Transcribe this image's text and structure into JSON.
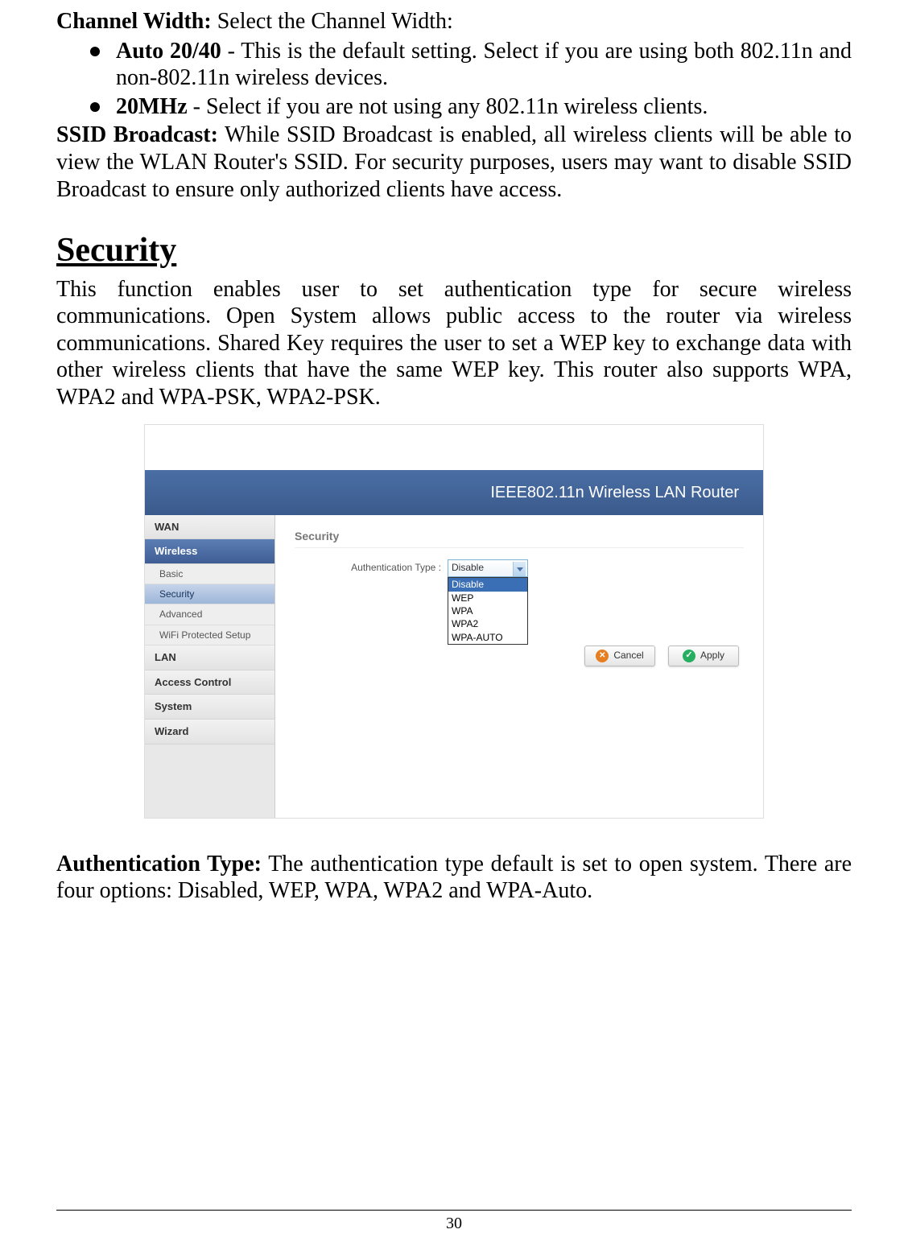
{
  "channel_width": {
    "label": "Channel Width:",
    "desc": " Select the Channel Width:",
    "auto": {
      "label": "Auto 20/40",
      "desc": " - This is the default setting. Select if you are using both 802.11n and non-802.11n wireless devices."
    },
    "twenty": {
      "label": "20MHz",
      "desc": " - Select if you are not using any 802.11n wireless clients."
    }
  },
  "ssid_broadcast": {
    "label": "SSID Broadcast:",
    "desc": " While SSID Broadcast is enabled, all wireless clients will be able to view the WLAN Router's SSID. For security purposes, users may want to disable SSID Broadcast to ensure only authorized clients have access."
  },
  "security": {
    "heading": "Security",
    "paragraph": "This function enables user to set authentication type for secure wireless communications. Open System allows public access to the router via wireless communications. Shared Key requires the user to set a WEP key to exchange data with other wireless clients that have the same WEP key. This router also supports WPA, WPA2 and WPA-PSK, WPA2-PSK."
  },
  "router_ui": {
    "header": "IEEE802.11n  Wireless LAN Router",
    "sidebar": {
      "wan": "WAN",
      "wireless": "Wireless",
      "basic": "Basic",
      "security": "Security",
      "advanced": "Advanced",
      "wps": "WiFi Protected Setup",
      "lan": "LAN",
      "access_control": "Access Control",
      "system": "System",
      "wizard": "Wizard"
    },
    "panel": {
      "title": "Security",
      "auth_label": "Authentication Type :",
      "selected": "Disable",
      "options": {
        "disable": "Disable",
        "wep": "WEP",
        "wpa": "WPA",
        "wpa2": "WPA2",
        "wpa_auto": "WPA-AUTO"
      },
      "cancel": "Cancel",
      "apply": "Apply"
    }
  },
  "auth_type": {
    "label": "Authentication Type:",
    "desc": "  The authentication type default is set to open system.  There are four options: Disabled, WEP, WPA, WPA2 and WPA-Auto."
  },
  "page_number": "30"
}
